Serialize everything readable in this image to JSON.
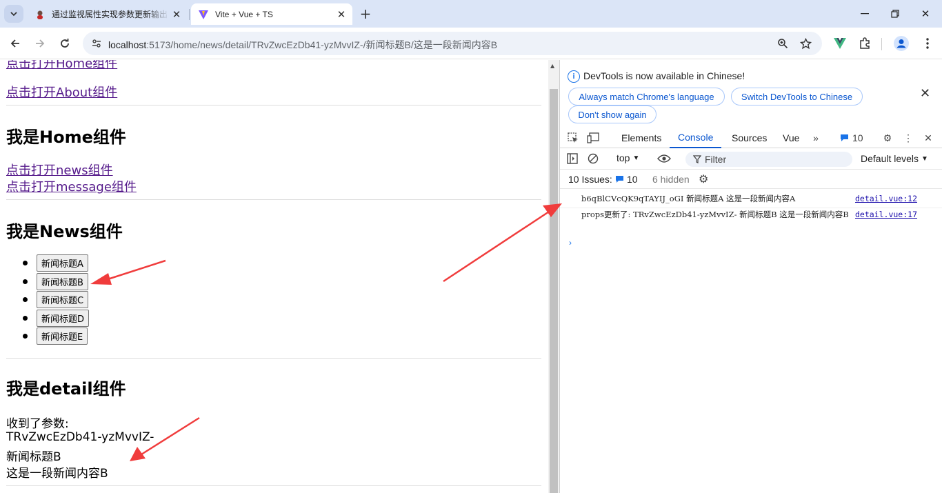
{
  "browser": {
    "tabs": [
      {
        "title": "通过监视属性实现参数更新输出",
        "active": false
      },
      {
        "title": "Vite + Vue + TS",
        "active": true
      }
    ],
    "url_host": "localhost",
    "url_rest": ":5173/home/news/detail/TRvZwcEzDb41-yzMvvIZ-/新闻标题B/这是一段新闻内容B"
  },
  "page": {
    "home_link": "点击打开Home组件",
    "about_link": "点击打开About组件",
    "home_heading": "我是Home组件",
    "news_link": "点击打开news组件",
    "message_link": "点击打开message组件",
    "news_heading": "我是News组件",
    "news_buttons": [
      "新闻标题A",
      "新闻标题B",
      "新闻标题C",
      "新闻标题D",
      "新闻标题E"
    ],
    "detail_heading": "我是detail组件",
    "detail_lines": [
      "收到了参数:",
      "TRvZwcEzDb41-yzMvvIZ-",
      "新闻标题B",
      "这是一段新闻内容B"
    ]
  },
  "devtools": {
    "info_text": "DevTools is now available in Chinese!",
    "btn_match": "Always match Chrome's language",
    "btn_switch": "Switch DevTools to Chinese",
    "btn_dont_show": "Don't show again",
    "tabs": [
      "Elements",
      "Console",
      "Sources",
      "Vue"
    ],
    "active_tab": "Console",
    "issue_badge_count": "10",
    "context": "top",
    "filter_placeholder": "Filter",
    "levels": "Default levels",
    "issues_label": "10 Issues:",
    "issues_count": "10",
    "hidden": "6 hidden",
    "messages": [
      {
        "text": "b6qBlCVcQK9qTAYIJ_oGI 新闻标题A 这是一段新闻内容A",
        "source": "detail.vue:12"
      },
      {
        "text": "props更新了: TRvZwcEzDb41-yzMvvIZ- 新闻标题B 这是一段新闻内容B",
        "source": "detail.vue:17"
      }
    ]
  },
  "colors": {
    "tabstrip": "#dbe5f7",
    "link_visited": "#551a8b",
    "home_link": "#008000",
    "devtools_accent": "#0b57d0",
    "arrow": "#f03c3c"
  }
}
